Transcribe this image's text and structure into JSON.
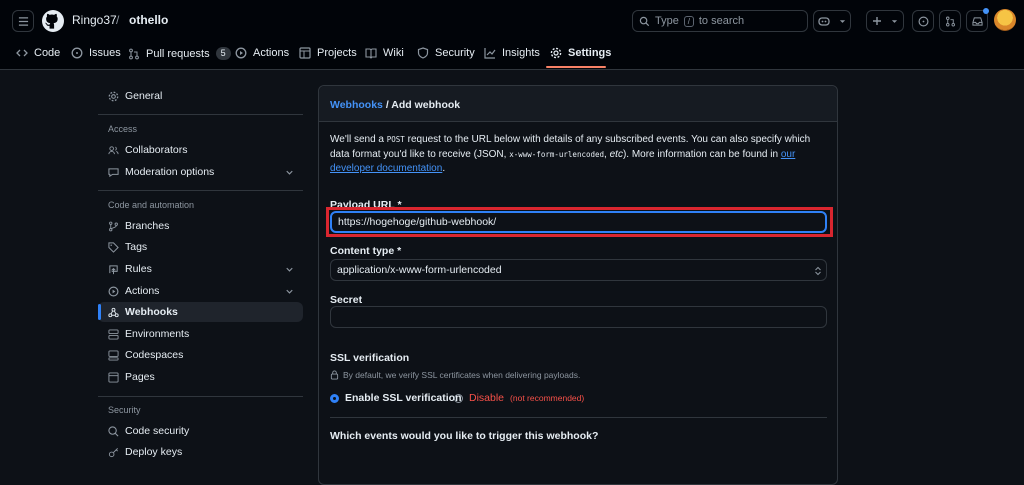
{
  "header": {
    "owner": "Ringo37",
    "separator": "/",
    "repo": "othello",
    "search_placeholder": "Type",
    "search_key": "/",
    "search_suffix": "to search",
    "brand_color": "#010409"
  },
  "tabs": [
    {
      "label": "Code",
      "icon": "code-icon"
    },
    {
      "label": "Issues",
      "icon": "issue-icon"
    },
    {
      "label": "Pull requests",
      "icon": "pull-request-icon",
      "count": "5"
    },
    {
      "label": "Actions",
      "icon": "play-icon"
    },
    {
      "label": "Projects",
      "icon": "table-icon"
    },
    {
      "label": "Wiki",
      "icon": "book-icon"
    },
    {
      "label": "Security",
      "icon": "shield-icon"
    },
    {
      "label": "Insights",
      "icon": "graph-icon"
    },
    {
      "label": "Settings",
      "icon": "gear-icon",
      "selected": true
    }
  ],
  "sidebar": {
    "general": "General",
    "access_heading": "Access",
    "collaborators": "Collaborators",
    "moderation": "Moderation options",
    "code_heading": "Code and automation",
    "branches": "Branches",
    "tags": "Tags",
    "rules": "Rules",
    "actions": "Actions",
    "webhooks": "Webhooks",
    "environments": "Environments",
    "codespaces": "Codespaces",
    "pages": "Pages",
    "security_heading": "Security",
    "code_security": "Code security",
    "deploy_keys": "Deploy keys"
  },
  "form": {
    "breadcrumb_link": "Webhooks",
    "breadcrumb_sep": "/",
    "breadcrumb_current": "Add webhook",
    "intro_1": "We'll send a",
    "intro_post": "POST",
    "intro_2": "request to the URL below with details of any subscribed events. You can also specify which data format you'd like to receive (JSON,",
    "intro_code": "x-www-form-urlencoded",
    "intro_3": ",",
    "intro_etc": "etc",
    "intro_4": "). More information can be found in",
    "intro_link": "our developer documentation",
    "intro_end": ".",
    "payload_label": "Payload URL *",
    "payload_value": "https://hogehoge/github-webhook/",
    "content_type_label": "Content type *",
    "content_type_value": "application/x-www-form-urlencoded",
    "secret_label": "Secret",
    "secret_value": "",
    "ssl_label": "SSL verification",
    "ssl_note": "By default, we verify SSL certificates when delivering payloads.",
    "ssl_enable": "Enable SSL verification",
    "ssl_disable": "Disable",
    "ssl_disable_note": "(not recommended)",
    "events_label": "Which events would you like to trigger this webhook?"
  }
}
